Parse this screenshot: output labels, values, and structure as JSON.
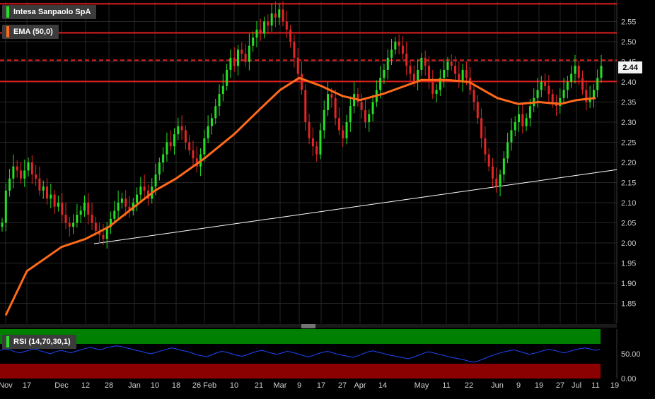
{
  "legend": {
    "instrument": "Intesa Sanpaolo SpA",
    "ema_label": "EMA (50,0)",
    "rsi_label": "RSI (14,70,30,1)"
  },
  "colors": {
    "background": "#000000",
    "grid": "#262626",
    "up_candle": "#26e026",
    "down_candle": "#e02626",
    "neutral_candle": "#b0b0b0",
    "ema": "#ff6a1a",
    "resistance": "#e01e1e",
    "trendline": "#ffffff",
    "rsi_line": "#1e46ff",
    "rsi_overbought": "#008000",
    "rsi_oversold": "#8b0000"
  },
  "chart_data": [
    {
      "type": "candlestick",
      "title": "Intesa Sanpaolo SpA",
      "ylim": [
        1.8,
        2.6
      ],
      "y_ticks": [
        "1.85",
        "1.90",
        "1.95",
        "2.00",
        "2.05",
        "2.10",
        "2.15",
        "2.20",
        "2.25",
        "2.30",
        "2.35",
        "2.40",
        "2.45",
        "2.50",
        "2.55"
      ],
      "x_tick_labels": [
        "Nov",
        "17",
        "Dec",
        "12",
        "28",
        "Jan",
        "10",
        "18",
        "26 Feb",
        "10",
        "21",
        "Mar",
        "9",
        "17",
        "27",
        "Apr",
        "14",
        "May",
        "11",
        "22",
        "Jun",
        "9",
        "19",
        "27",
        "Jul",
        "11",
        "19"
      ],
      "last_price_label": "2.44",
      "horizontal_lines": [
        {
          "value": 2.594,
          "style": "solid"
        },
        {
          "value": 2.522,
          "style": "solid"
        },
        {
          "value": 2.454,
          "style": "dashed"
        },
        {
          "value": 2.401,
          "style": "solid"
        }
      ],
      "trendline": {
        "from": [
          "Dec 21",
          1.998
        ],
        "to": [
          "Jul 19+",
          2.182
        ]
      },
      "ema_series": {
        "name": "EMA (50,0)",
        "points": [
          [
            "Nov",
            1.82
          ],
          [
            "17",
            1.93
          ],
          [
            "Dec",
            1.99
          ],
          [
            "12",
            2.01
          ],
          [
            "28",
            2.04
          ],
          [
            "Jan",
            2.09
          ],
          [
            "10",
            2.13
          ],
          [
            "18",
            2.16
          ],
          [
            "26 Feb",
            2.21
          ],
          [
            "10",
            2.27
          ],
          [
            "21",
            2.33
          ],
          [
            "Mar",
            2.38
          ],
          [
            "9",
            2.41
          ],
          [
            "17",
            2.39
          ],
          [
            "27",
            2.365
          ],
          [
            "Apr",
            2.355
          ],
          [
            "14",
            2.37
          ],
          [
            "May",
            2.405
          ],
          [
            "11",
            2.405
          ],
          [
            "22",
            2.4
          ],
          [
            "Jun",
            2.36
          ],
          [
            "9",
            2.345
          ],
          [
            "19",
            2.35
          ],
          [
            "27",
            2.345
          ],
          [
            "Jul",
            2.355
          ],
          [
            "11",
            2.36
          ]
        ]
      },
      "candle_closes": [
        2.05,
        2.13,
        2.16,
        2.19,
        2.18,
        2.16,
        2.18,
        2.2,
        2.17,
        2.16,
        2.13,
        2.14,
        2.11,
        2.12,
        2.09,
        2.1,
        2.07,
        2.05,
        2.04,
        2.05,
        2.07,
        2.08,
        2.1,
        2.07,
        2.05,
        2.03,
        2.02,
        2.01,
        2.04,
        2.06,
        2.08,
        2.1,
        2.11,
        2.09,
        2.08,
        2.1,
        2.12,
        2.14,
        2.13,
        2.11,
        2.14,
        2.17,
        2.2,
        2.22,
        2.25,
        2.24,
        2.27,
        2.29,
        2.28,
        2.25,
        2.23,
        2.21,
        2.19,
        2.22,
        2.26,
        2.29,
        2.31,
        2.34,
        2.37,
        2.39,
        2.43,
        2.46,
        2.44,
        2.48,
        2.47,
        2.45,
        2.49,
        2.51,
        2.53,
        2.52,
        2.55,
        2.54,
        2.57,
        2.56,
        2.58,
        2.55,
        2.53,
        2.5,
        2.46,
        2.42,
        2.38,
        2.3,
        2.26,
        2.24,
        2.22,
        2.28,
        2.33,
        2.37,
        2.36,
        2.31,
        2.28,
        2.26,
        2.3,
        2.34,
        2.37,
        2.35,
        2.33,
        2.3,
        2.32,
        2.35,
        2.38,
        2.41,
        2.43,
        2.46,
        2.48,
        2.5,
        2.49,
        2.47,
        2.44,
        2.42,
        2.4,
        2.43,
        2.46,
        2.44,
        2.4,
        2.37,
        2.38,
        2.41,
        2.43,
        2.45,
        2.44,
        2.42,
        2.4,
        2.43,
        2.41,
        2.38,
        2.35,
        2.31,
        2.26,
        2.22,
        2.19,
        2.16,
        2.14,
        2.17,
        2.21,
        2.25,
        2.28,
        2.3,
        2.32,
        2.29,
        2.31,
        2.34,
        2.36,
        2.38,
        2.4,
        2.39,
        2.37,
        2.35,
        2.34,
        2.36,
        2.38,
        2.4,
        2.42,
        2.44,
        2.41,
        2.38,
        2.35,
        2.36,
        2.38,
        2.41,
        2.44
      ]
    },
    {
      "type": "line",
      "title": "RSI (14,70,30,1)",
      "ylim": [
        0,
        100
      ],
      "y_ticks": [
        "0.00",
        "50.00"
      ],
      "zones": [
        {
          "from": 70,
          "to": 100,
          "label": "overbought"
        },
        {
          "from": 0,
          "to": 30,
          "label": "oversold"
        }
      ],
      "series": [
        {
          "name": "RSI (14,70,30,1)",
          "values": [
            57,
            60,
            58,
            54,
            52,
            55,
            58,
            60,
            56,
            53,
            50,
            54,
            57,
            55,
            52,
            55,
            58,
            61,
            63,
            60,
            58,
            62,
            64,
            66,
            65,
            62,
            60,
            57,
            55,
            52,
            50,
            53,
            56,
            59,
            62,
            60,
            57,
            55,
            52,
            48,
            46,
            44,
            48,
            52,
            55,
            53,
            50,
            47,
            45,
            48,
            52,
            55,
            57,
            54,
            51,
            49,
            52,
            55,
            53,
            50,
            47,
            44,
            46,
            50,
            53,
            55,
            52,
            49,
            47,
            45,
            43,
            46,
            50,
            54,
            56,
            53,
            51,
            48,
            46,
            44,
            42,
            40,
            43,
            47,
            51,
            54,
            52,
            49,
            47,
            44,
            42,
            40,
            38,
            35,
            33,
            36,
            40,
            44,
            48,
            51,
            54,
            56,
            58,
            55,
            52,
            49,
            51,
            54,
            57,
            59,
            57,
            54,
            52,
            55,
            58,
            60,
            62,
            60,
            57,
            59
          ]
        }
      ]
    }
  ]
}
